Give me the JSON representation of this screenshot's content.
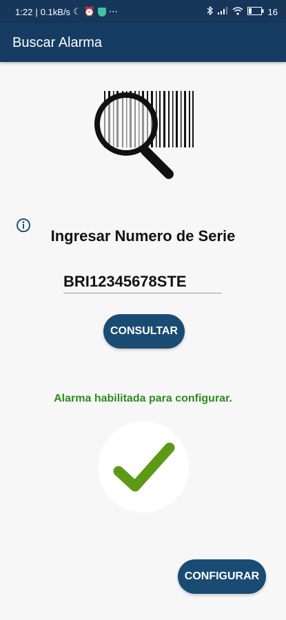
{
  "status_bar": {
    "time": "1:22",
    "network_speed": "0.1kB/s",
    "battery": "16",
    "icons": [
      "moon-icon",
      "alarm-clock-icon",
      "shield-icon",
      "more-icon",
      "bluetooth-icon",
      "signal-icon",
      "wifi-icon",
      "battery-icon"
    ]
  },
  "app_bar": {
    "title": "Buscar Alarma"
  },
  "main": {
    "illustration_icon": "barcode-magnifier-icon",
    "info_icon": "info-icon",
    "field_label": "Ingresar Numero de Serie",
    "serial_value": "BRI12345678STE",
    "consult_button": "CONSULTAR",
    "status_message": "Alarma habilitada para configurar.",
    "check_icon": "checkmark-icon",
    "configure_button": "CONFIGURAR"
  },
  "colors": {
    "app_bar": "#173c63",
    "button": "#1a4b73",
    "success_text": "#2e8b1f",
    "checkmark": "#5c9a16"
  }
}
